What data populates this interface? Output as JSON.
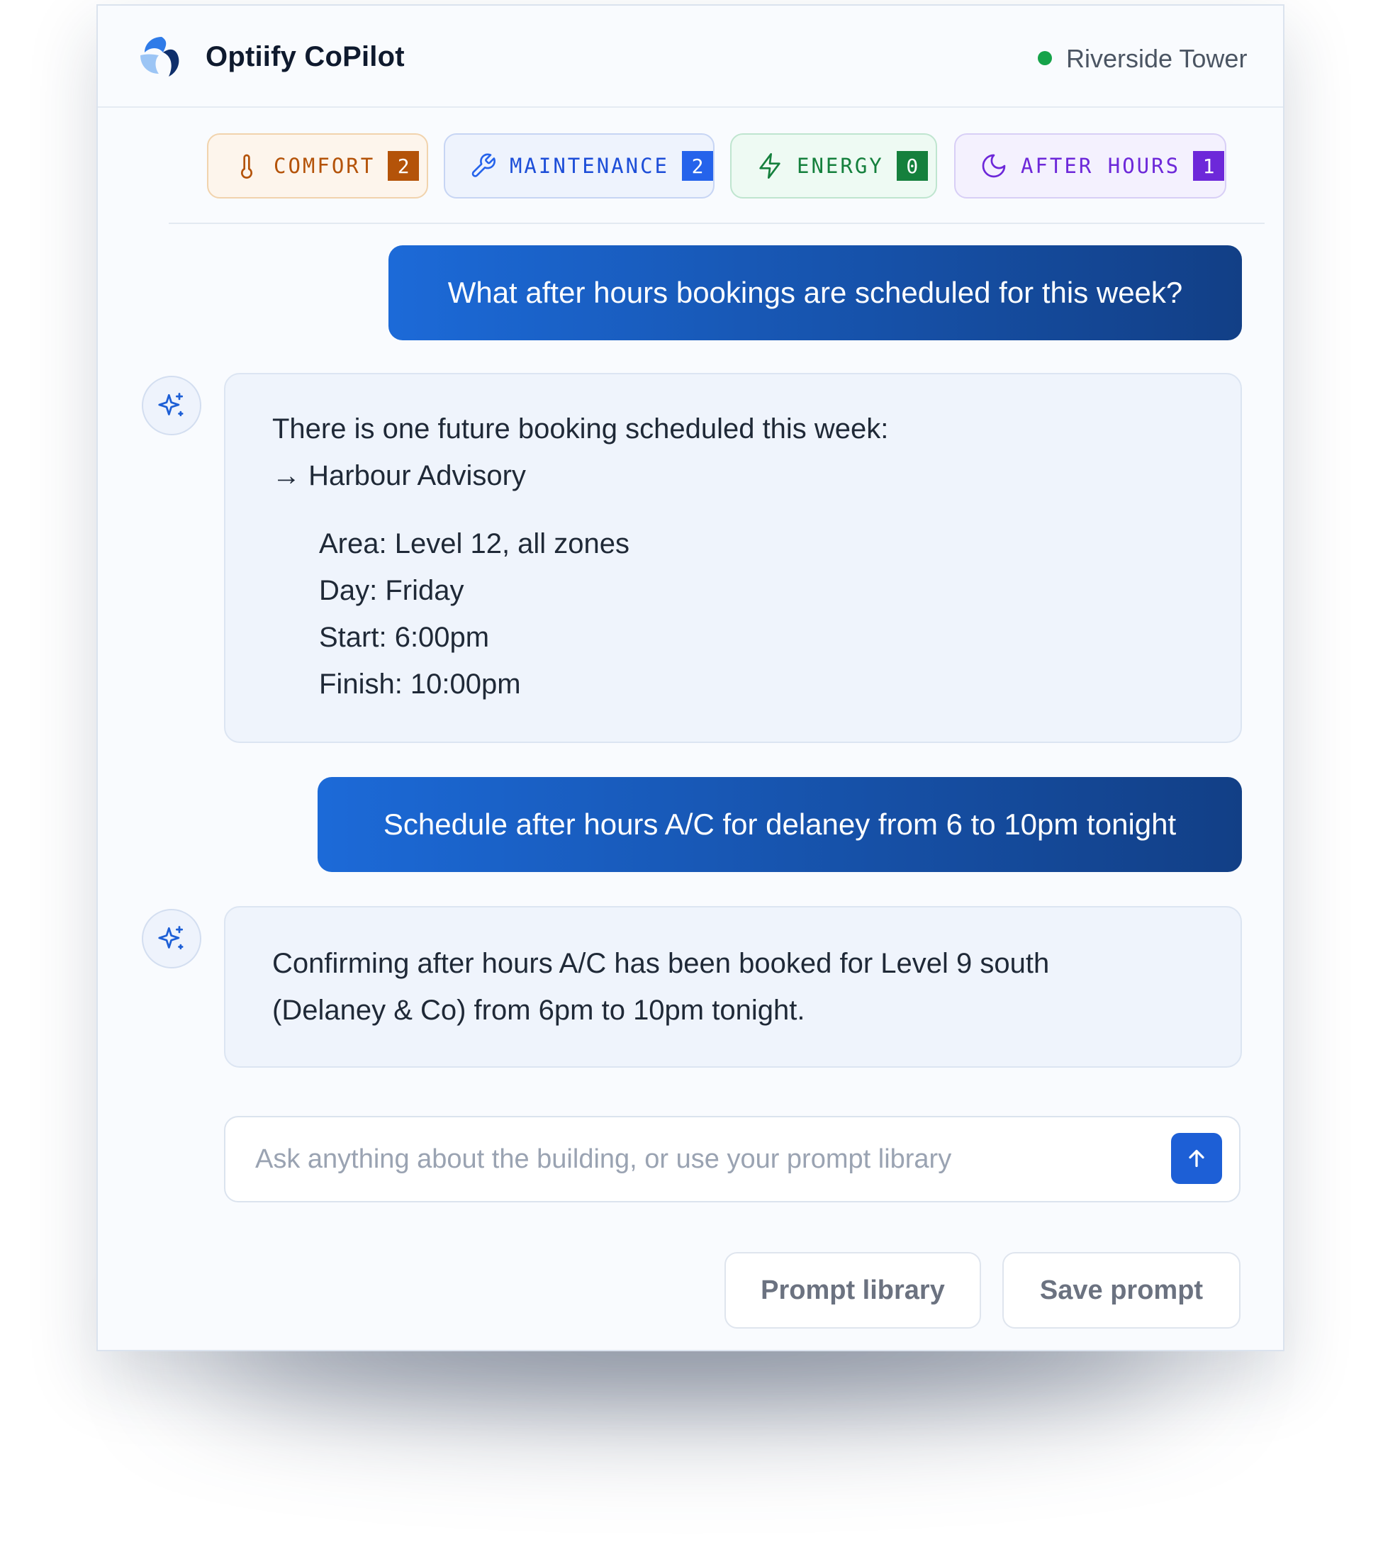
{
  "app": {
    "title": "Optiify CoPilot",
    "building": "Riverside Tower",
    "status_color": "#16a34a",
    "logo_icon": "optiify-logo-icon"
  },
  "categories": [
    {
      "label": "COMFORT",
      "count": "2",
      "icon": "thermometer-icon",
      "color": "#b45309"
    },
    {
      "label": "MAINTENANCE",
      "count": "2",
      "icon": "wrench-icon",
      "color": "#2563eb"
    },
    {
      "label": "ENERGY",
      "count": "0",
      "icon": "lightning-icon",
      "color": "#15803d"
    },
    {
      "label": "AFTER HOURS",
      "count": "1",
      "icon": "moon-icon",
      "color": "#6d28d9"
    }
  ],
  "conversation": {
    "user_1": "What after hours bookings are scheduled for this week?",
    "assistant_1": {
      "intro": "There is one future booking scheduled this week:",
      "tenant": "→ Harbour Advisory",
      "area": "Area: Level 12, all zones",
      "day": "Day: Friday",
      "start": "Start: 6:00pm",
      "finish": "Finish: 10:00pm"
    },
    "user_2": "Schedule after hours A/C for delaney from 6 to 10pm tonight",
    "assistant_2": {
      "line1": "Confirming after hours A/C has been booked for Level 9 south",
      "line2": "(Delaney & Co) from 6pm to 10pm tonight."
    },
    "assistant_icon": "sparkles-icon"
  },
  "composer": {
    "placeholder": "Ask anything about the building, or use your prompt library",
    "value": "",
    "send_icon": "arrow-up-icon"
  },
  "actions": {
    "prompt_library": "Prompt library",
    "save_prompt": "Save prompt"
  },
  "colors": {
    "accent": "#1d5fd6",
    "user_bubble_start": "#1c6ad8",
    "user_bubble_end": "#123f86",
    "assistant_bubble": "#eff4fc"
  }
}
